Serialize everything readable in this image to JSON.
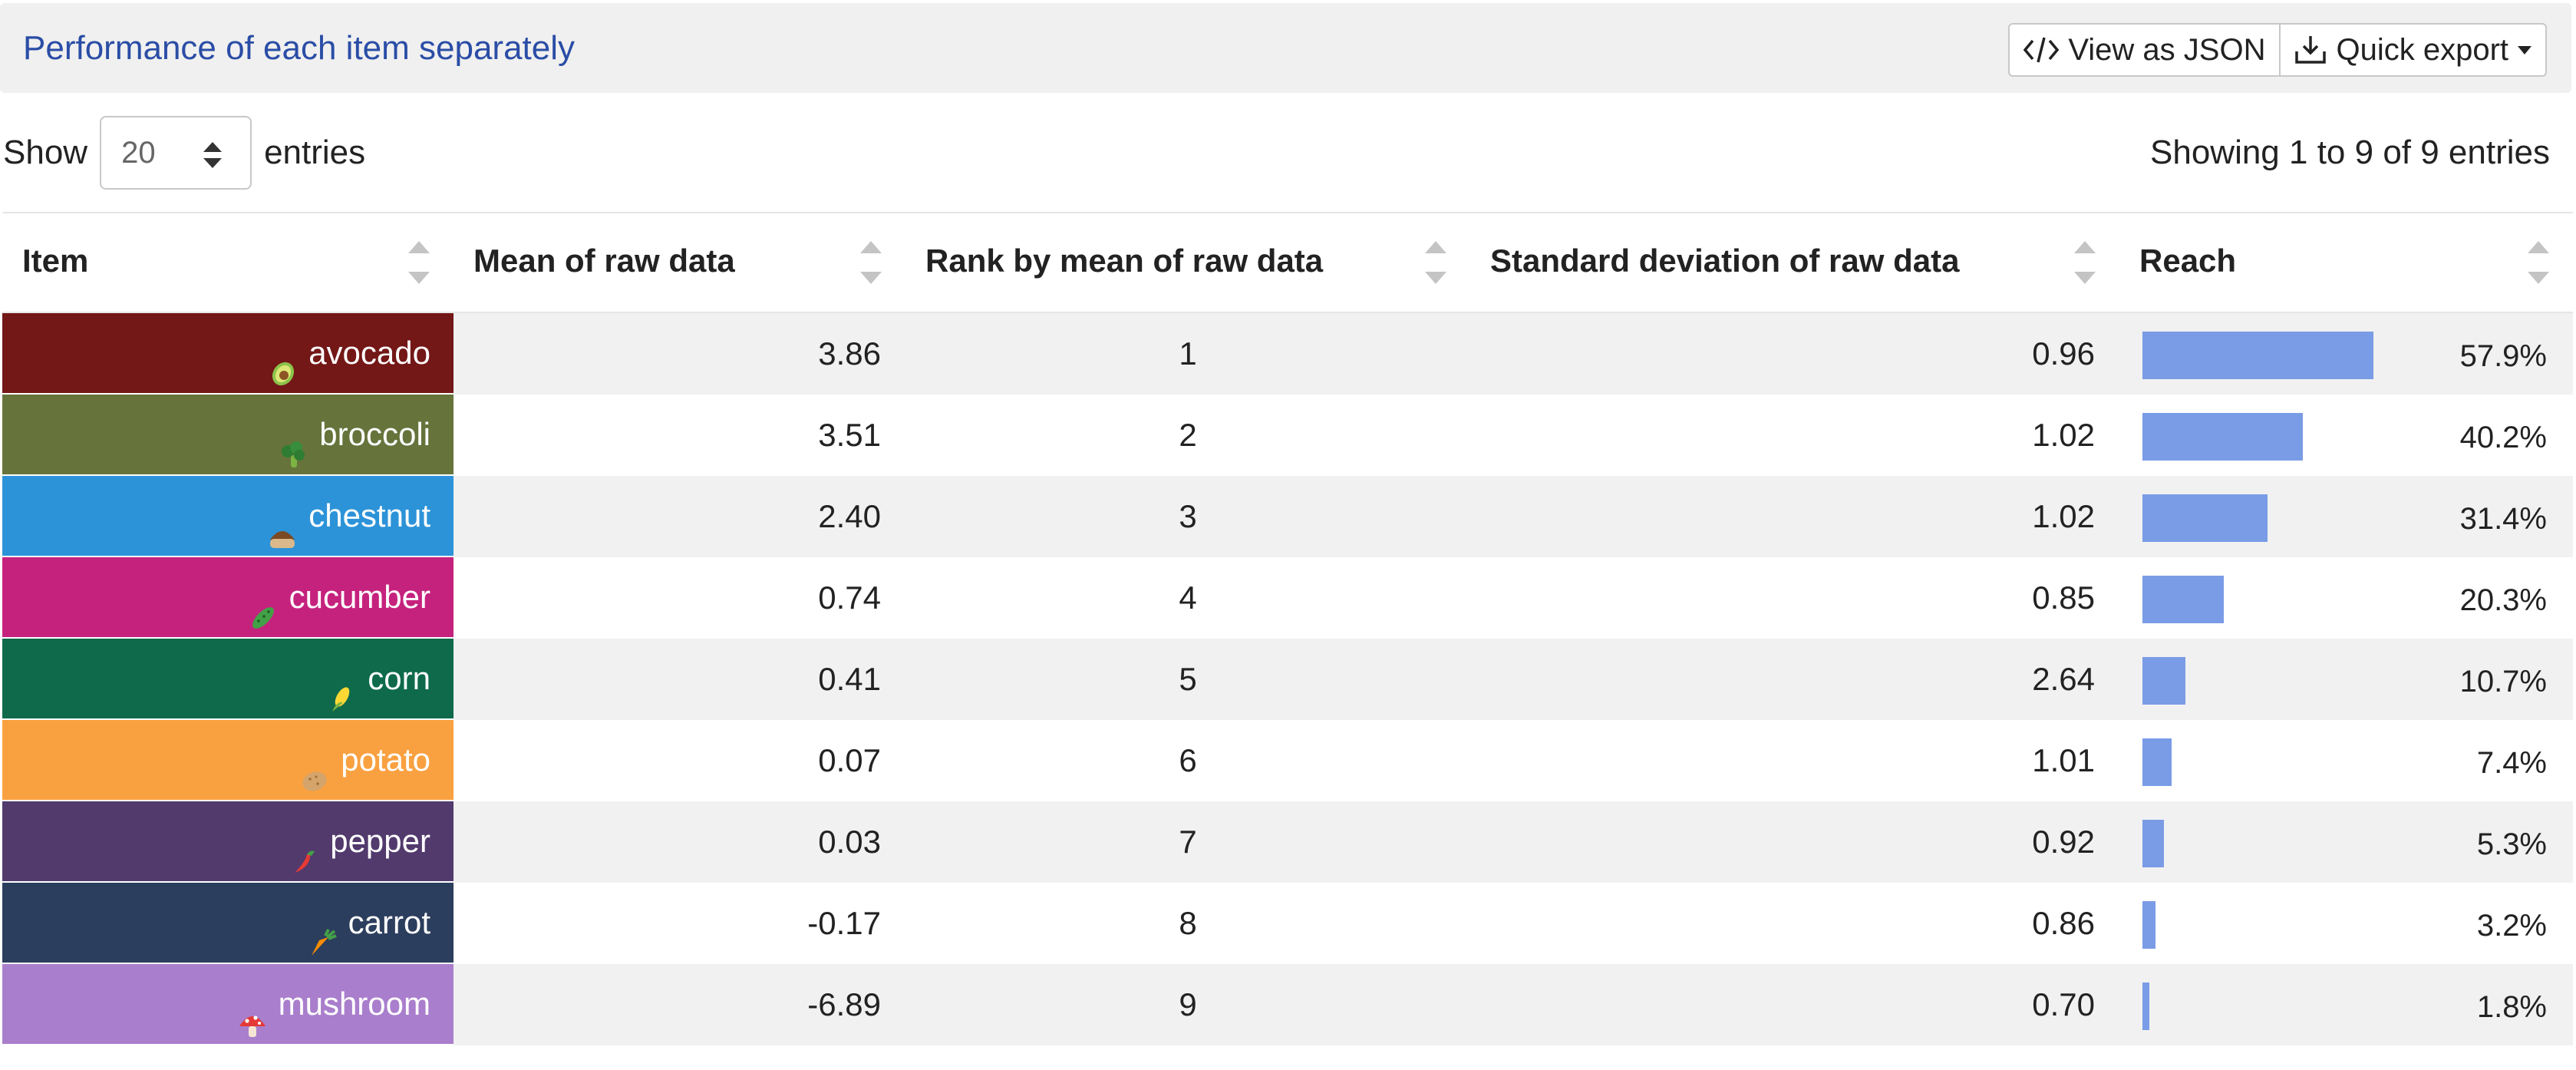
{
  "header": {
    "title": "Performance of each item separately",
    "view_json_label": "View as JSON",
    "export_label": "Quick export"
  },
  "controls": {
    "show_label": "Show",
    "page_size": "20",
    "entries_label": "entries",
    "info": "Showing 1 to 9 of 9 entries"
  },
  "table": {
    "columns": [
      "Item",
      "Mean of raw data",
      "Rank by mean of raw data",
      "Standard deviation of raw data",
      "Reach"
    ],
    "rows": [
      {
        "item": "avocado",
        "icon": "avocado-icon",
        "color": "#731717",
        "mean": "3.86",
        "rank": "1",
        "std": "0.96",
        "reach": 0.579,
        "reach_label": "57.9%"
      },
      {
        "item": "broccoli",
        "icon": "broccoli-icon",
        "color": "#66733b",
        "mean": "3.51",
        "rank": "2",
        "std": "1.02",
        "reach": 0.402,
        "reach_label": "40.2%"
      },
      {
        "item": "chestnut",
        "icon": "chestnut-icon",
        "color": "#2d93d8",
        "mean": "2.40",
        "rank": "3",
        "std": "1.02",
        "reach": 0.314,
        "reach_label": "31.4%"
      },
      {
        "item": "cucumber",
        "icon": "cucumber-icon",
        "color": "#c5227e",
        "mean": "0.74",
        "rank": "4",
        "std": "0.85",
        "reach": 0.203,
        "reach_label": "20.3%"
      },
      {
        "item": "corn",
        "icon": "corn-icon",
        "color": "#0e6a4a",
        "mean": "0.41",
        "rank": "5",
        "std": "2.64",
        "reach": 0.107,
        "reach_label": "10.7%"
      },
      {
        "item": "potato",
        "icon": "potato-icon",
        "color": "#f9a141",
        "mean": "0.07",
        "rank": "6",
        "std": "1.01",
        "reach": 0.074,
        "reach_label": "7.4%"
      },
      {
        "item": "pepper",
        "icon": "pepper-icon",
        "color": "#523a6d",
        "mean": "0.03",
        "rank": "7",
        "std": "0.92",
        "reach": 0.053,
        "reach_label": "5.3%"
      },
      {
        "item": "carrot",
        "icon": "carrot-icon",
        "color": "#2c3e5e",
        "mean": "-0.17",
        "rank": "8",
        "std": "0.86",
        "reach": 0.032,
        "reach_label": "3.2%"
      },
      {
        "item": "mushroom",
        "icon": "mushroom-icon",
        "color": "#a97ecc",
        "mean": "-6.89",
        "rank": "9",
        "std": "0.70",
        "reach": 0.018,
        "reach_label": "1.8%"
      }
    ]
  },
  "colors": {
    "reach_bar": "#7a9ce6",
    "title": "#2a4da6"
  }
}
